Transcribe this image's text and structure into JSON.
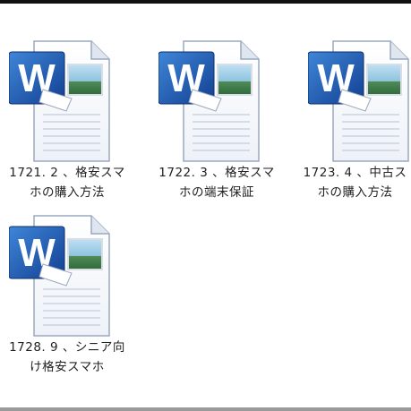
{
  "files": [
    {
      "line1": "1721. 2 、格安スマ",
      "line2": "ホの購入方法",
      "icon": "word-document-icon"
    },
    {
      "line1": "1722. 3 、格安スマ",
      "line2": "ホの端末保証",
      "icon": "word-document-icon"
    },
    {
      "line1": "1723. 4 、中古ス",
      "line2": "ホの購入方法",
      "icon": "word-document-icon"
    },
    {
      "line1": "1728. 9 、シニア向",
      "line2": "け格安スマホ",
      "icon": "word-document-icon"
    }
  ],
  "icon_text": "W",
  "colors": {
    "word_blue": "#1f5fb8",
    "page_lines": "#c9d3e4"
  }
}
